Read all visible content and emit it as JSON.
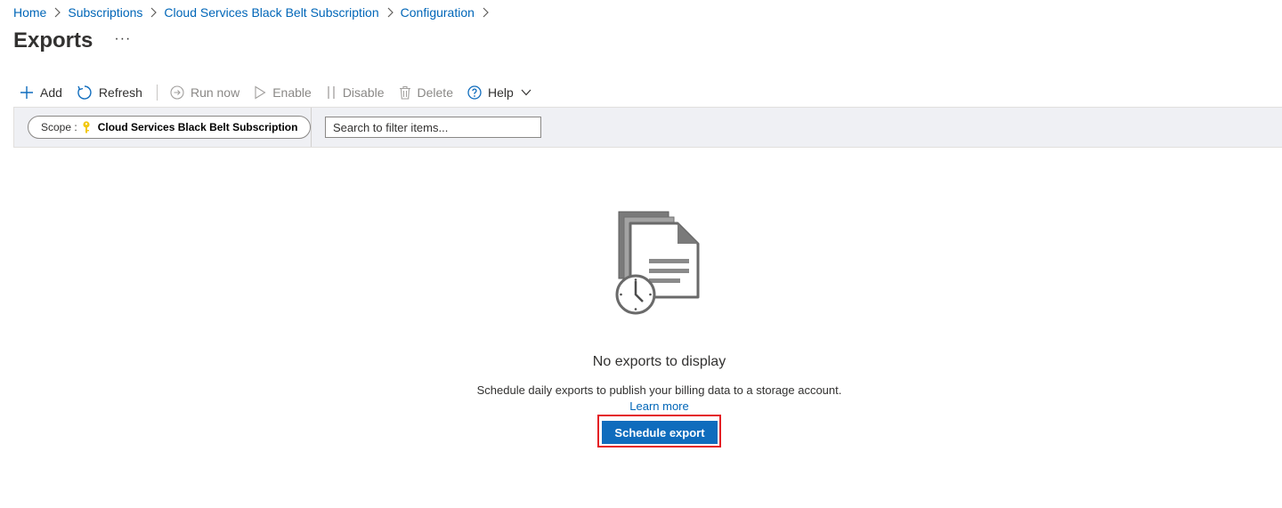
{
  "breadcrumb": {
    "items": [
      "Home",
      "Subscriptions",
      "Cloud Services Black Belt Subscription",
      "Configuration"
    ]
  },
  "page": {
    "title": "Exports",
    "more_label": "···"
  },
  "toolbar": {
    "add": "Add",
    "refresh": "Refresh",
    "run_now": "Run now",
    "enable": "Enable",
    "disable": "Disable",
    "delete": "Delete",
    "help": "Help"
  },
  "filter": {
    "scope_label": "Scope :",
    "scope_value": "Cloud Services Black Belt Subscription",
    "search_placeholder": "Search to filter items..."
  },
  "empty_state": {
    "title": "No exports to display",
    "description": "Schedule daily exports to publish your billing data to a storage account.",
    "learn_more": "Learn more",
    "button": "Schedule export"
  },
  "colors": {
    "link": "#0066b8",
    "primary": "#0f6cbd",
    "highlight": "#e41f24",
    "filter_bar": "#eff0f4",
    "scope_key": "#f2c811"
  },
  "icons": [
    "chevron-right-icon",
    "more-icon",
    "add-icon",
    "refresh-icon",
    "run-now-icon",
    "enable-icon",
    "disable-icon",
    "delete-icon",
    "help-icon",
    "chevron-down-icon",
    "key-icon",
    "exports-illustration"
  ]
}
